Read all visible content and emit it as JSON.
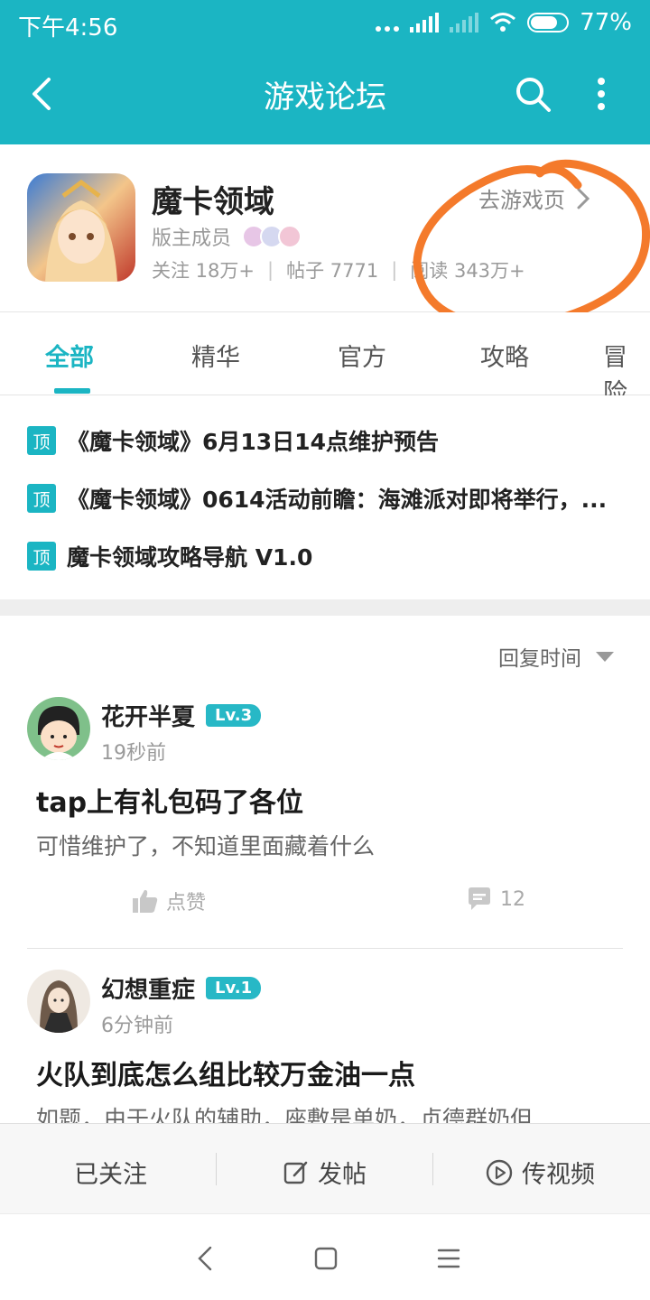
{
  "status_bar": {
    "time": "下午4:56",
    "battery": "77%"
  },
  "top_bar": {
    "title": "游戏论坛"
  },
  "forum": {
    "name": "魔卡领域",
    "moderators_label": "版主成员",
    "stats": {
      "follow": "关注 18万+",
      "posts": "帖子 7771",
      "reads": "阅读 343万+"
    },
    "go_game_label": "去游戏页"
  },
  "tabs": [
    {
      "label": "全部",
      "active": true
    },
    {
      "label": "精华",
      "active": false
    },
    {
      "label": "官方",
      "active": false
    },
    {
      "label": "攻略",
      "active": false
    },
    {
      "label": "冒险",
      "active": false
    }
  ],
  "pinned": {
    "badge": "顶",
    "items": [
      "《魔卡领域》6月13日14点维护预告",
      "《魔卡领域》0614活动前瞻：海滩派对即将举行，...",
      "魔卡领域攻略导航 V1.0"
    ]
  },
  "feed": {
    "sort_label": "回复时间",
    "posts": [
      {
        "author": "花开半夏",
        "level": "Lv.3",
        "time": "19秒前",
        "title": "tap上有礼包码了各位",
        "body": "可惜维护了，不知道里面藏着什么",
        "like_label": "点赞",
        "comments": "12"
      },
      {
        "author": "幻想重症",
        "level": "Lv.1",
        "time": "6分钟前",
        "title": "火队到底怎么组比较万金油一点",
        "body": "如题，由于火队的辅助，座敷是单奶，贞德群奶但..."
      }
    ]
  },
  "action_bar": {
    "follow": "已关注",
    "post": "发帖",
    "video": "传视频"
  },
  "colors": {
    "accent": "#1bb5c3",
    "annotation": "#f47a2b"
  }
}
